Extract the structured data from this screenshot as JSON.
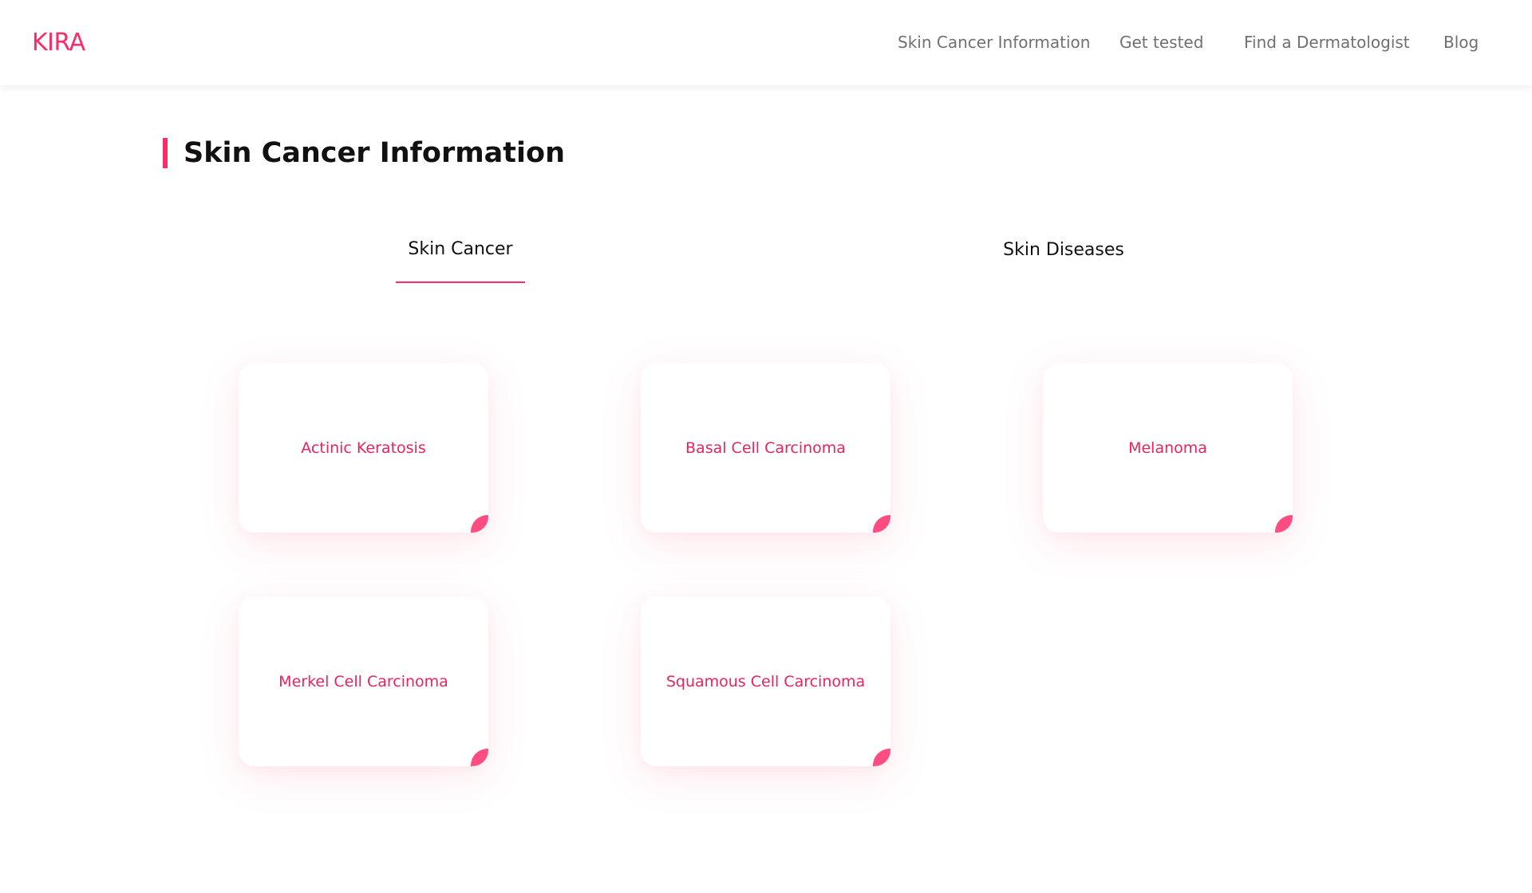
{
  "brand": {
    "logo": "KIRA",
    "accent_color": "#ff2b68"
  },
  "nav": {
    "links": [
      "Skin Cancer Information",
      "Get tested",
      "Find a Dermatologist",
      "Blog"
    ]
  },
  "page": {
    "title": "Skin Cancer Information"
  },
  "tabs": [
    {
      "label": "Skin Cancer",
      "active": true
    },
    {
      "label": "Skin Diseases",
      "active": false
    }
  ],
  "cards": [
    {
      "label": "Actinic Keratosis"
    },
    {
      "label": "Basal Cell Carcinoma"
    },
    {
      "label": "Melanoma"
    },
    {
      "label": "Merkel Cell Carcinoma"
    },
    {
      "label": "Squamous Cell Carcinoma"
    }
  ]
}
